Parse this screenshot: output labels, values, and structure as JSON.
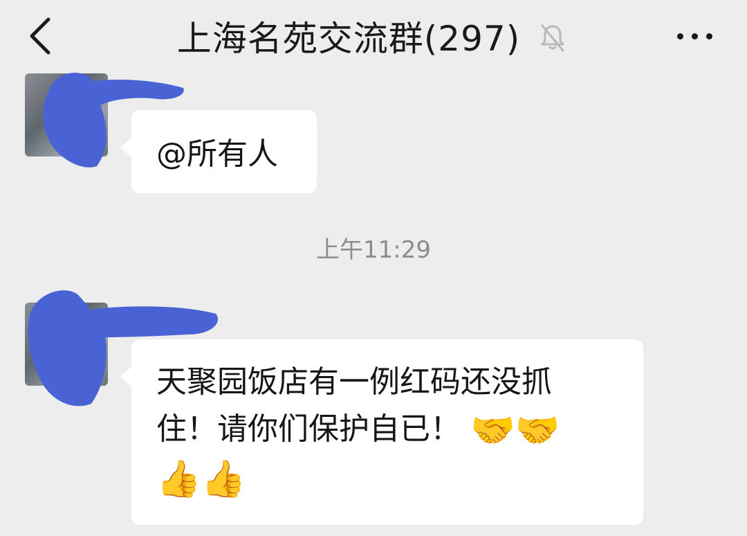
{
  "header": {
    "title": "上海名苑交流群(297)",
    "back_icon": "chevron-left-icon",
    "mute_icon": "bell-muted-icon",
    "more_icon": "more-dots-icon"
  },
  "messages": [
    {
      "text_lines": [
        "@所有人"
      ],
      "emojis": []
    },
    {
      "timestamp": "上午11:29",
      "text_lines": [
        "天聚园饭店有一例红码还没抓",
        "住！请你们保护自已！"
      ],
      "emojis_line2": [
        "🤝",
        "🤝"
      ],
      "emojis_line3": [
        "👍",
        "👍"
      ]
    }
  ],
  "colors": {
    "background": "#ededed",
    "bubble": "#ffffff",
    "redaction": "#4a63d4",
    "timestamp": "#8c8c8c"
  }
}
